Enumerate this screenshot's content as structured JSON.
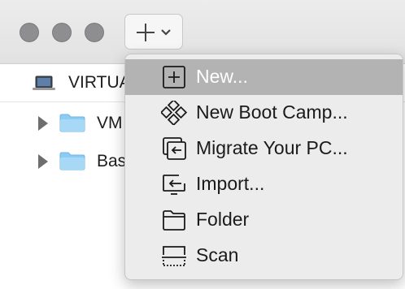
{
  "toolbar": {
    "traffic_lights": [
      "close",
      "minimize",
      "zoom"
    ],
    "add_button_icons": [
      "plus-icon",
      "chevron-down-icon"
    ]
  },
  "sidebar": {
    "header_label": "VIRTUA",
    "items": [
      {
        "label": "VM",
        "icon": "folder-icon"
      },
      {
        "label": "Bas",
        "icon": "folder-icon"
      }
    ]
  },
  "menu": {
    "selected_index": 0,
    "items": [
      {
        "label": "New...",
        "icon": "plus-square-icon"
      },
      {
        "label": "New Boot Camp...",
        "icon": "bootcamp-diamond-icon"
      },
      {
        "label": "Migrate Your PC...",
        "icon": "migrate-icon"
      },
      {
        "label": "Import...",
        "icon": "import-icon"
      },
      {
        "label": "Folder",
        "icon": "folder-outline-icon"
      },
      {
        "label": "Scan",
        "icon": "scan-icon"
      }
    ]
  },
  "colors": {
    "folder_blue": "#7fc4f0",
    "menu_selected": "#b3b3b3",
    "menu_background": "#ececec"
  }
}
